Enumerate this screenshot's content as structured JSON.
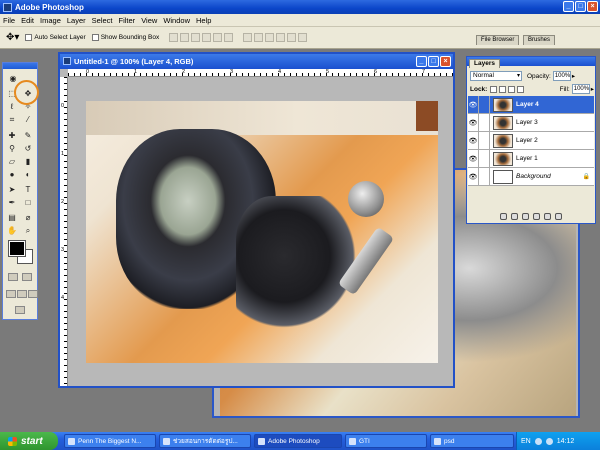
{
  "app": {
    "title": "Adobe Photoshop"
  },
  "menu": [
    "File",
    "Edit",
    "Image",
    "Layer",
    "Select",
    "Filter",
    "View",
    "Window",
    "Help"
  ],
  "options": {
    "auto_select_label": "Auto Select Layer",
    "bounding_box_label": "Show Bounding Box"
  },
  "palette_tabs": {
    "file_browser": "File Browser",
    "brushes": "Brushes"
  },
  "document": {
    "title": "Untitled-1 @ 100% (Layer 4, RGB)",
    "ruler_h": [
      "0",
      "1",
      "2",
      "3",
      "4",
      "5",
      "6",
      "7"
    ],
    "ruler_v": [
      "0",
      "1",
      "2",
      "3",
      "4"
    ]
  },
  "layers_panel": {
    "tab": "Layers",
    "blend_mode": "Normal",
    "opacity_label": "Opacity:",
    "opacity_value": "100%",
    "lock_label": "Lock:",
    "fill_label": "Fill:",
    "fill_value": "100%",
    "layers": [
      {
        "name": "Layer 4",
        "active": true
      },
      {
        "name": "Layer 3",
        "active": false
      },
      {
        "name": "Layer 2",
        "active": false
      },
      {
        "name": "Layer 1",
        "active": false
      },
      {
        "name": "Background",
        "active": false,
        "locked": true
      }
    ]
  },
  "taskbar": {
    "start_label": "start",
    "items": [
      "Penn The Biggest N...",
      "ช่วยสอนการตัดต่อรูป...",
      "Adobe Photoshop",
      "GTI",
      "psd"
    ],
    "active_index": 2,
    "lang": "EN",
    "clock": "14:12"
  },
  "colors": {
    "title_blue": "#1a50cf",
    "active_layer": "#3166d4",
    "highlight": "#e68a1f"
  }
}
